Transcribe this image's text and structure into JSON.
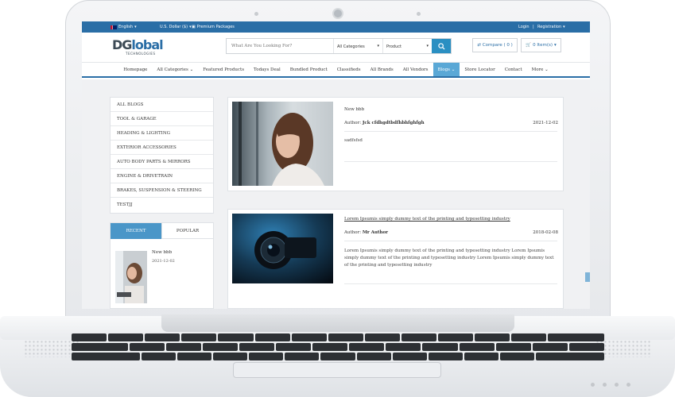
{
  "topbar": {
    "language": "English",
    "currency": "U.S. Dollar ($)",
    "premium": "Premium Packages",
    "login": "Login",
    "separator": "|",
    "registration": "Registration"
  },
  "logo": {
    "main_prefix": "DG",
    "main_suffix": "lobal",
    "sub": "TECHNOLOGIES"
  },
  "search": {
    "placeholder": "What Are You Looking For?",
    "category": "All Categories",
    "type": "Product"
  },
  "header_buttons": {
    "compare": "Compare ( 0 )",
    "cart": "0 Item(s)"
  },
  "nav": [
    "Homepage",
    "All Categories",
    "Featured Products",
    "Todays Deal",
    "Bundled Product",
    "Classifieds",
    "All Brands",
    "All Vendors",
    "Blogs",
    "Store Locator",
    "Contact",
    "More"
  ],
  "nav_dropdown_marker": "⌄",
  "categories": [
    "ALL BLOGS",
    "TOOL & GARAGE",
    "HEADING & LIGHTING",
    "EXTERIOR ACCESSORIES",
    "AUTO BODY PARTS & MIRRORS",
    "ENGINE & DRIVETRAIN",
    "BRAKES, SUSPENSION & STEERING",
    "TESTJJ"
  ],
  "sidebar_tabs": {
    "recent": "RECENT",
    "popular": "POPULAR"
  },
  "recent_post": {
    "title": "New bbb",
    "date": "2021-12-02"
  },
  "posts": [
    {
      "title": "New bbb",
      "author_label": "Author:",
      "author": "Jck cfdhgdtbdfhbhfghfgh",
      "date": "2021-12-02",
      "excerpt": "sadfsfsd"
    },
    {
      "title": "Lorem Ipsumis simply dummy text of the printing and typesetting industry",
      "author_label": "Author:",
      "author": "Mr Author",
      "date": "2018-02-08",
      "excerpt": "Lorem Ipsumis simply dummy text of the printing and typesetting industry Lorem Ipsumis simply dummy text of the printing and typesetting industry Lorem Ipsumis simply dummy text of the printing and typesetting industry"
    }
  ],
  "colors": {
    "brand": "#2a6ea6",
    "accent": "#4a96c8",
    "search_button": "#2a8fc2"
  }
}
